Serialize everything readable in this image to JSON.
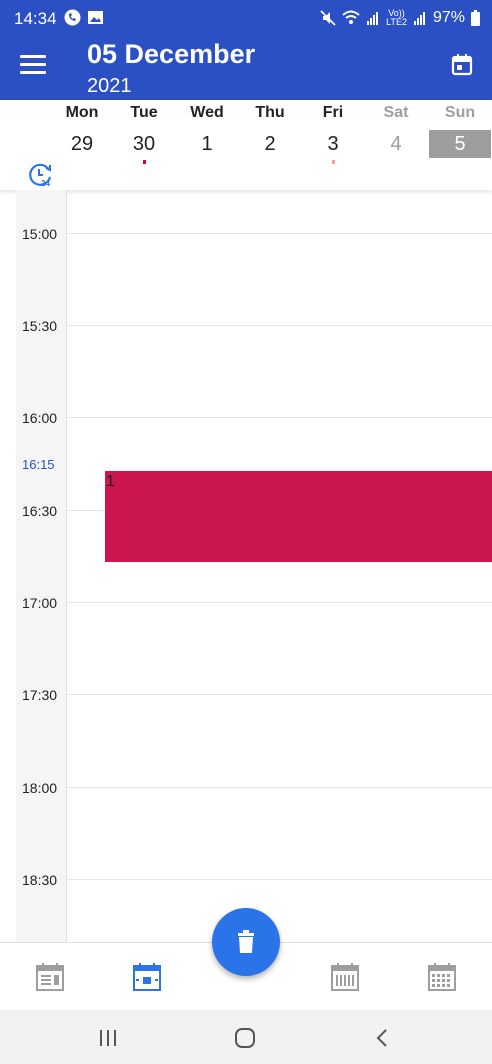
{
  "status_bar": {
    "time": "14:34",
    "lte_label_top": "Vo))",
    "lte_label_bottom": "LTE2",
    "battery": "97%"
  },
  "app_bar": {
    "title": "05 December",
    "subtitle": "2021",
    "menu_icon": "hamburger-menu-icon",
    "calendar_icon": "calendar-icon"
  },
  "week": {
    "days": [
      {
        "name": "Mon",
        "num": "29"
      },
      {
        "name": "Tue",
        "num": "30"
      },
      {
        "name": "Wed",
        "num": "1"
      },
      {
        "name": "Thu",
        "num": "2"
      },
      {
        "name": "Fri",
        "num": "3"
      },
      {
        "name": "Sat",
        "num": "4"
      },
      {
        "name": "Sun",
        "num": "5"
      }
    ],
    "selected_day": "Sun",
    "dot_colors": {
      "tue": "#e3002a",
      "fri": "#ff9aaa"
    }
  },
  "timeline": {
    "labels": [
      "15:00",
      "15:30",
      "16:00",
      "16:15",
      "16:30",
      "17:00",
      "17:30",
      "18:00",
      "18:30"
    ],
    "current_time": "16:15"
  },
  "event": {
    "title": "1",
    "color": "#cc1650"
  },
  "colors": {
    "primary": "#2b50c4",
    "accent": "#2a73e8",
    "event": "#cc1650"
  }
}
